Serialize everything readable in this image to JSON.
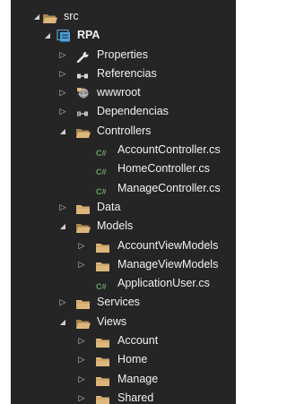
{
  "explorer": {
    "items": [
      {
        "label": "src",
        "state": "expanded",
        "icon": "folder-open-icon",
        "depth": 0
      },
      {
        "label": "RPA",
        "state": "expanded",
        "icon": "csharp-project-icon",
        "depth": 1
      },
      {
        "label": "Properties",
        "state": "collapsed",
        "icon": "wrench-icon",
        "depth": 2
      },
      {
        "label": "Referencias",
        "state": "collapsed",
        "icon": "references-icon",
        "depth": 2
      },
      {
        "label": "wwwroot",
        "state": "collapsed",
        "icon": "globe-icon",
        "depth": 2
      },
      {
        "label": "Dependencias",
        "state": "collapsed",
        "icon": "dependencies-icon",
        "depth": 2
      },
      {
        "label": "Controllers",
        "state": "expanded",
        "icon": "folder-open-icon",
        "depth": 2
      },
      {
        "label": "AccountController.cs",
        "state": "leaf",
        "icon": "csharp-file-icon",
        "depth": 3
      },
      {
        "label": "HomeController.cs",
        "state": "leaf",
        "icon": "csharp-file-icon",
        "depth": 3
      },
      {
        "label": "ManageController.cs",
        "state": "leaf",
        "icon": "csharp-file-icon",
        "depth": 3
      },
      {
        "label": "Data",
        "state": "collapsed",
        "icon": "folder-icon",
        "depth": 2
      },
      {
        "label": "Models",
        "state": "expanded",
        "icon": "folder-open-icon",
        "depth": 2
      },
      {
        "label": "AccountViewModels",
        "state": "collapsed",
        "icon": "folder-icon",
        "depth": 3
      },
      {
        "label": "ManageViewModels",
        "state": "collapsed",
        "icon": "folder-icon",
        "depth": 3
      },
      {
        "label": "ApplicationUser.cs",
        "state": "leaf",
        "icon": "csharp-file-icon",
        "depth": 3
      },
      {
        "label": "Services",
        "state": "collapsed",
        "icon": "folder-icon",
        "depth": 2
      },
      {
        "label": "Views",
        "state": "expanded",
        "icon": "folder-open-icon",
        "depth": 2
      },
      {
        "label": "Account",
        "state": "collapsed",
        "icon": "folder-icon",
        "depth": 3
      },
      {
        "label": "Home",
        "state": "collapsed",
        "icon": "folder-icon",
        "depth": 3
      },
      {
        "label": "Manage",
        "state": "collapsed",
        "icon": "folder-icon",
        "depth": 3
      },
      {
        "label": "Shared",
        "state": "collapsed",
        "icon": "folder-icon",
        "depth": 3
      }
    ],
    "csharp_badge": "C#",
    "colors": {
      "background": "#252526",
      "text": "#f1f1f1",
      "folder": "#dcb67a",
      "csharp": "#68a063",
      "project": "#4f9fd8"
    }
  }
}
